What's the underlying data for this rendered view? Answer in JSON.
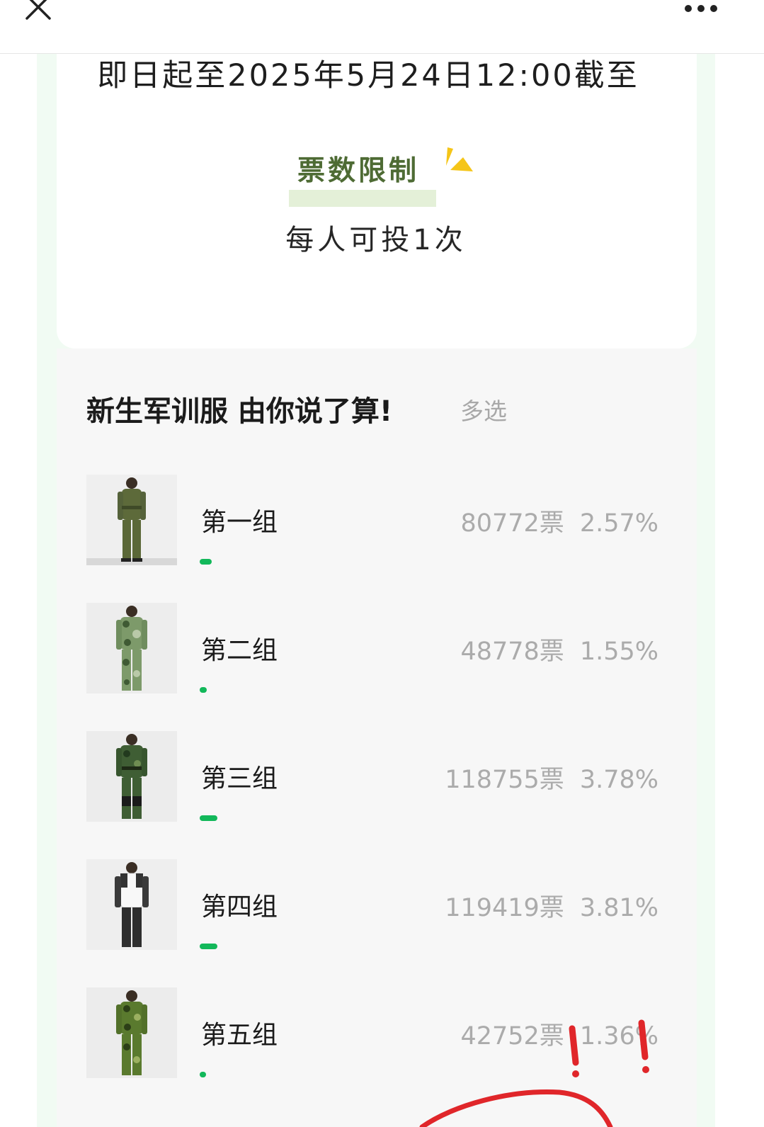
{
  "nav": {
    "close_icon": "close-icon",
    "more_icon": "more-dots-icon"
  },
  "header_card": {
    "deadline_text": "即日起至2025年5月24日12:00截至",
    "limit_title": "票数限制",
    "limit_value": "每人可投1次",
    "accent_color": "#4e6b34",
    "deco_icon": "triangle-spark-icon",
    "deco_color": "#f5c518"
  },
  "poll": {
    "title": "新生军训服 由你说了算!",
    "mode": "多选",
    "bar_color": "#12b85a",
    "options": [
      {
        "name": "第一组",
        "votes": "80772票",
        "percent": "2.57%",
        "percent_value": 2.57,
        "image_icon": "uniform-photo-olive"
      },
      {
        "name": "第二组",
        "votes": "48778票",
        "percent": "1.55%",
        "percent_value": 1.55,
        "image_icon": "uniform-photo-camo-light"
      },
      {
        "name": "第三组",
        "votes": "118755票",
        "percent": "3.78%",
        "percent_value": 3.78,
        "image_icon": "uniform-photo-camo-dark"
      },
      {
        "name": "第四组",
        "votes": "119419票",
        "percent": "3.81%",
        "percent_value": 3.81,
        "image_icon": "uniform-photo-tracksuit"
      },
      {
        "name": "第五组",
        "votes": "42752票",
        "percent": "1.36%",
        "percent_value": 1.36,
        "image_icon": "uniform-photo-camo-green"
      }
    ]
  },
  "annotation": {
    "color": "#e0262a",
    "marks": "!!"
  }
}
